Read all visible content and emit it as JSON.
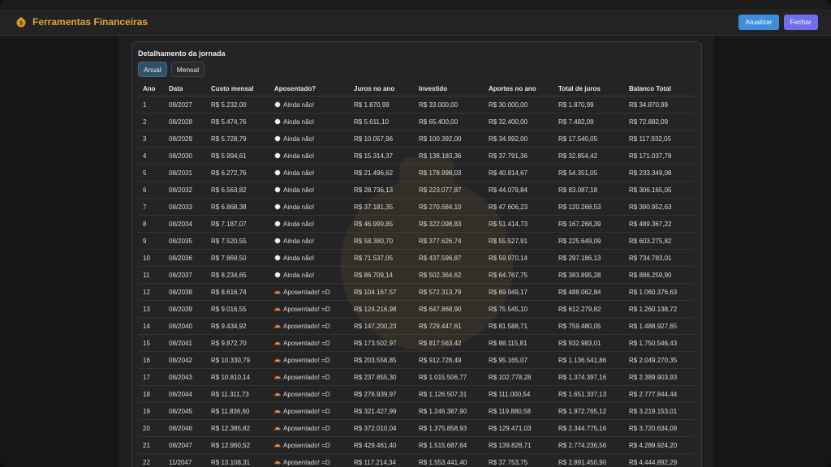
{
  "app": {
    "title": "Ferramentas Financeiras",
    "buttons": {
      "refresh": "Atualizar",
      "close": "Fechar"
    }
  },
  "card": {
    "title": "Detalhamento da jornada",
    "tabs": [
      {
        "label": "Anual",
        "active": true
      },
      {
        "label": "Mensal",
        "active": false
      }
    ]
  },
  "table": {
    "headers": [
      "Ano",
      "Data",
      "Custo mensal",
      "Aposentado?",
      "Juros no ano",
      "Investido",
      "Aportes no ano",
      "Total de juros",
      "Balanco Total"
    ],
    "rows": [
      [
        "1",
        "08/2027",
        "R$ 5.232,00",
        "Ainda não!",
        "R$ 1.870,99",
        "R$ 33.000,00",
        "R$ 30.000,00",
        "R$ 1.870,99",
        "R$ 34.870,99"
      ],
      [
        "2",
        "08/2028",
        "R$ 5.474,76",
        "Ainda não!",
        "R$ 5.611,10",
        "R$ 65.400,00",
        "R$ 32.400,00",
        "R$ 7.482,09",
        "R$ 72.882,09"
      ],
      [
        "3",
        "08/2029",
        "R$ 5.728,79",
        "Ainda não!",
        "R$ 10.057,96",
        "R$ 100.392,00",
        "R$ 34.992,00",
        "R$ 17.540,05",
        "R$ 117.932,05"
      ],
      [
        "4",
        "08/2030",
        "R$ 5.994,61",
        "Ainda não!",
        "R$ 15.314,37",
        "R$ 138.183,36",
        "R$ 37.791,36",
        "R$ 32.854,42",
        "R$ 171.037,78"
      ],
      [
        "5",
        "08/2031",
        "R$ 6.272,76",
        "Ainda não!",
        "R$ 21.496,62",
        "R$ 178.998,03",
        "R$ 40.814,67",
        "R$ 54.351,05",
        "R$ 233.349,08"
      ],
      [
        "6",
        "08/2032",
        "R$ 6.563,82",
        "Ainda não!",
        "R$ 28.736,13",
        "R$ 223.077,87",
        "R$ 44.079,84",
        "R$ 83.087,18",
        "R$ 306.165,05"
      ],
      [
        "7",
        "08/2033",
        "R$ 6.868,38",
        "Ainda não!",
        "R$ 37.181,35",
        "R$ 270.684,10",
        "R$ 47.606,23",
        "R$ 120.268,53",
        "R$ 390.952,63"
      ],
      [
        "8",
        "08/2034",
        "R$ 7.187,07",
        "Ainda não!",
        "R$ 46.999,85",
        "R$ 322.098,83",
        "R$ 51.414,73",
        "R$ 167.268,39",
        "R$ 489.367,22"
      ],
      [
        "9",
        "08/2035",
        "R$ 7.520,55",
        "Ainda não!",
        "R$ 58.380,70",
        "R$ 377.626,74",
        "R$ 55.527,91",
        "R$ 225.649,09",
        "R$ 603.275,82"
      ],
      [
        "10",
        "08/2036",
        "R$ 7.869,50",
        "Ainda não!",
        "R$ 71.537,05",
        "R$ 437.596,87",
        "R$ 59.970,14",
        "R$ 297.186,13",
        "R$ 734.783,01"
      ],
      [
        "11",
        "08/2037",
        "R$ 8.234,65",
        "Ainda não!",
        "R$ 86.709,14",
        "R$ 502.364,62",
        "R$ 64.767,75",
        "R$ 383.895,28",
        "R$ 886.259,90"
      ],
      [
        "12",
        "08/2038",
        "R$ 8.616,74",
        "Aposentado! =D",
        "R$ 104.167,57",
        "R$ 572.313,79",
        "R$ 69.949,17",
        "R$ 488.062,84",
        "R$ 1.060.376,63"
      ],
      [
        "13",
        "08/2039",
        "R$ 9.016,55",
        "Aposentado! =D",
        "R$ 124.216,98",
        "R$ 647.868,90",
        "R$ 75.545,10",
        "R$ 612.279,82",
        "R$ 1.260.138,72"
      ],
      [
        "14",
        "08/2040",
        "R$ 9.434,92",
        "Aposentado! =D",
        "R$ 147.200,23",
        "R$ 729.447,61",
        "R$ 81.588,71",
        "R$ 759.480,05",
        "R$ 1.488.927,65"
      ],
      [
        "15",
        "08/2041",
        "R$ 9.872,70",
        "Aposentado! =D",
        "R$ 173.502,97",
        "R$ 817.563,42",
        "R$ 88.115,81",
        "R$ 932.983,01",
        "R$ 1.750.546,43"
      ],
      [
        "16",
        "08/2042",
        "R$ 10.330,79",
        "Aposentado! =D",
        "R$ 203.558,85",
        "R$ 912.728,49",
        "R$ 95.165,07",
        "R$ 1.136.541,86",
        "R$ 2.049.270,35"
      ],
      [
        "17",
        "08/2043",
        "R$ 10.810,14",
        "Aposentado! =D",
        "R$ 237.855,30",
        "R$ 1.015.506,77",
        "R$ 102.778,28",
        "R$ 1.374.397,16",
        "R$ 2.389.903,93"
      ],
      [
        "18",
        "08/2044",
        "R$ 11.311,73",
        "Aposentado! =D",
        "R$ 276.939,97",
        "R$ 1.126.507,31",
        "R$ 111.000,54",
        "R$ 1.651.337,13",
        "R$ 2.777.844,44"
      ],
      [
        "19",
        "08/2045",
        "R$ 11.836,60",
        "Aposentado! =D",
        "R$ 321.427,99",
        "R$ 1.246.387,90",
        "R$ 119.880,58",
        "R$ 1.972.765,12",
        "R$ 3.219.153,01"
      ],
      [
        "20",
        "08/2046",
        "R$ 12.385,82",
        "Aposentado! =D",
        "R$ 372.010,04",
        "R$ 1.375.858,93",
        "R$ 129.471,03",
        "R$ 2.344.775,16",
        "R$ 3.720.634,09"
      ],
      [
        "21",
        "08/2047",
        "R$ 12.960,52",
        "Aposentado! =D",
        "R$ 429.461,40",
        "R$ 1.515.687,64",
        "R$ 139.828,71",
        "R$ 2.774.236,56",
        "R$ 4.289.924,20"
      ],
      [
        "22",
        "11/2047",
        "R$ 13.108,31",
        "Aposentado! =D",
        "R$ 117.214,34",
        "R$ 1.553.441,40",
        "R$ 37.753,75",
        "R$ 2.891.450,90",
        "R$ 4.444.892,29"
      ]
    ]
  },
  "icons": {
    "not_retired": "white-circle-icon",
    "retired": "rainbow-icon"
  },
  "colors": {
    "accent_title": "#e3a53a",
    "button_refresh": "#3d8fdc",
    "button_close": "#6f6fe8",
    "tab_active": "#2e5168"
  }
}
